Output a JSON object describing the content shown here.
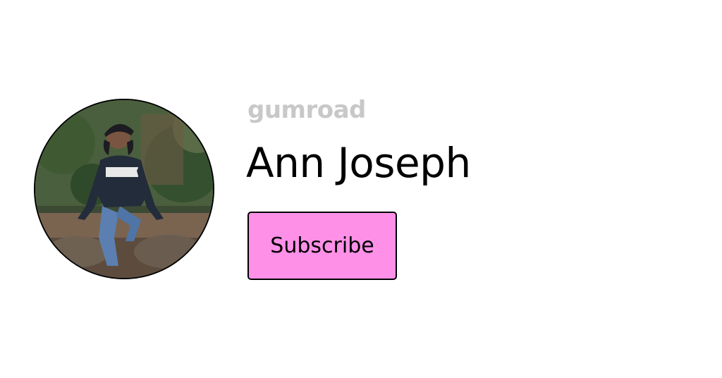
{
  "brand": {
    "name": "Gumroad",
    "color": "#c8c8c8"
  },
  "profile": {
    "name": "Ann Joseph",
    "avatar_icon": "profile-photo"
  },
  "actions": {
    "subscribe_label": "Subscribe",
    "accent": "#ff90e8"
  }
}
